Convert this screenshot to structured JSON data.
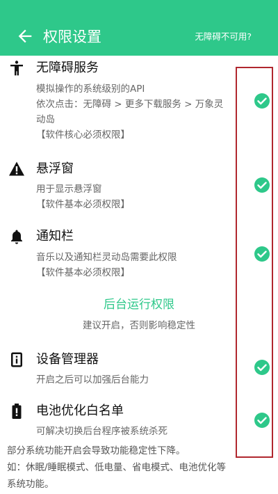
{
  "appbar": {
    "title": "权限设置",
    "action": "无障碍不可用?",
    "color": "#2ec88a"
  },
  "sections": [
    {
      "icon": "person-accessibility-icon",
      "title": "无障碍服务",
      "desc": [
        "模拟操作的系统级别的API",
        "依次点击：无障碍 > 更多下载服务 > 万象灵",
        "动岛",
        "【软件核心必须权限】"
      ],
      "granted": true
    },
    {
      "icon": "warning-triangle-icon",
      "title": "悬浮窗",
      "desc": [
        "用于显示悬浮窗",
        "【软件基本必须权限】"
      ],
      "granted": true
    },
    {
      "icon": "bell-icon",
      "title": "通知栏",
      "desc": [
        "音乐以及通知栏灵动岛需要此权限",
        "【软件基本必须权限】"
      ],
      "granted": true
    }
  ],
  "background": {
    "title": "后台运行权限",
    "subtitle": "建议开启，否则影响稳定性"
  },
  "bg_sections": [
    {
      "icon": "device-manager-icon",
      "title": "设备管理器",
      "desc": [
        "开启之后可以加强后台能力"
      ],
      "granted": true
    },
    {
      "icon": "battery-icon",
      "title": "电池优化白名单",
      "desc": [
        "可解决切换后台程序被系统杀死"
      ],
      "granted": true
    }
  ],
  "footer": [
    "部分系统功能开启会导致功能稳定性下降。",
    "如：休眠/睡眠模式、低电量、省电模式、电池优化等",
    "系统功能。"
  ],
  "colors": {
    "accent": "#2ec88a",
    "highlight_box": "#b0272e"
  }
}
